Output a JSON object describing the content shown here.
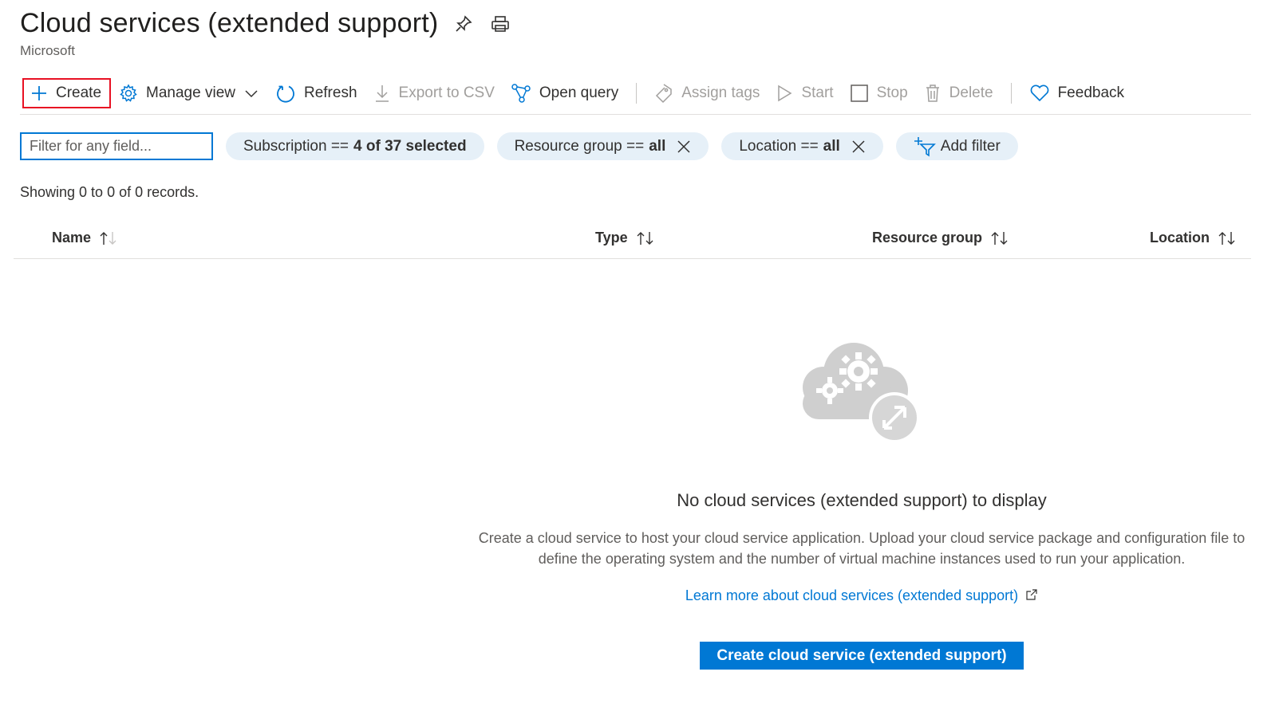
{
  "header": {
    "title": "Cloud services (extended support)",
    "subtitle": "Microsoft"
  },
  "toolbar": {
    "create": "Create",
    "manage_view": "Manage view",
    "refresh": "Refresh",
    "export_csv": "Export to CSV",
    "open_query": "Open query",
    "assign_tags": "Assign tags",
    "start": "Start",
    "stop": "Stop",
    "delete": "Delete",
    "feedback": "Feedback"
  },
  "filters": {
    "placeholder": "Filter for any field...",
    "subscription_label": "Subscription ==",
    "subscription_value": "4 of 37 selected",
    "resource_group_label": "Resource group ==",
    "resource_group_value": "all",
    "location_label": "Location ==",
    "location_value": "all",
    "add_filter": "Add filter"
  },
  "records": {
    "showing": "Showing 0 to 0 of 0 records."
  },
  "columns": [
    "Name",
    "Type",
    "Resource group",
    "Location"
  ],
  "empty_state": {
    "title": "No cloud services (extended support) to display",
    "description_line1": "Create a cloud service to host your cloud service application. Upload your cloud service package and configuration file to",
    "description_line2": "define the operating system and the number of virtual machine instances used to run your application.",
    "learn_more": "Learn more about cloud services (extended support)",
    "button": "Create cloud service (extended support)"
  },
  "colors": {
    "accent": "#0078d4",
    "highlight_border": "#e81123",
    "pill_bg": "#e6f0f8"
  },
  "icons": [
    "pin-icon",
    "print-icon",
    "plus-icon",
    "gear-icon",
    "chevron-down-icon",
    "refresh-icon",
    "download-icon",
    "query-icon",
    "tag-icon",
    "play-icon",
    "stop-icon",
    "trash-icon",
    "heart-icon",
    "close-icon",
    "add-filter-icon",
    "sort-icon",
    "cloud-gears-icon",
    "external-link-icon"
  ]
}
